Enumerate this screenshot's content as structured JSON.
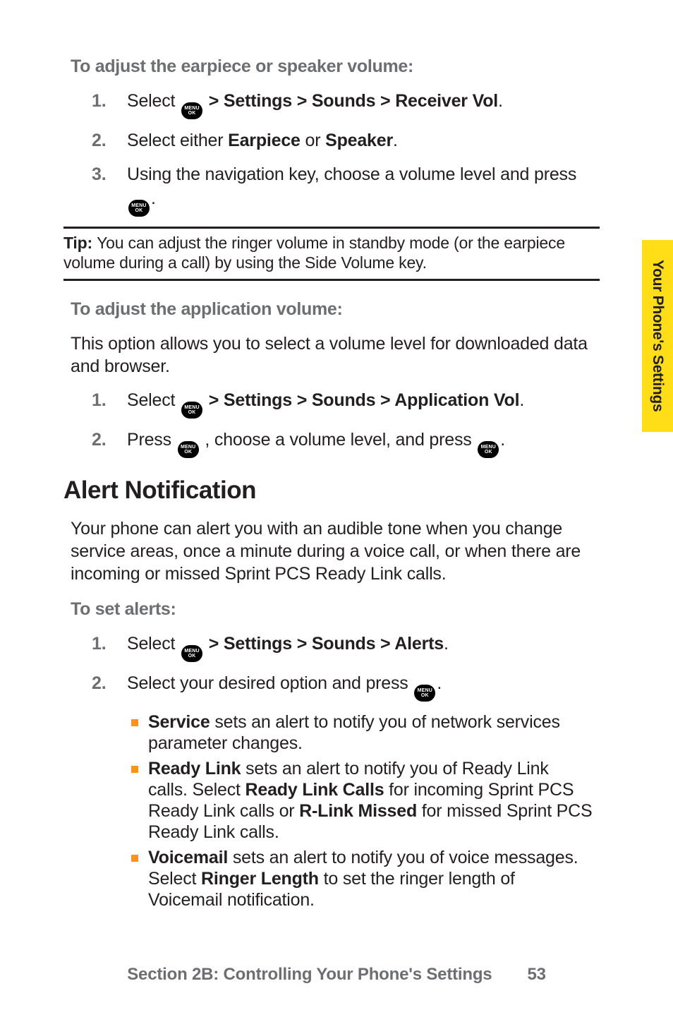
{
  "sidetab": {
    "label": "Your Phone's Settings"
  },
  "sec1": {
    "heading": "To adjust the earpiece or speaker volume:",
    "steps": [
      {
        "num": "1.",
        "pre": "Select ",
        "post": " > Settings > Sounds > Receiver Vol",
        "end": "."
      },
      {
        "num": "2.",
        "text_a": "Select either ",
        "b1": "Earpiece",
        "mid": " or ",
        "b2": "Speaker",
        "end": "."
      },
      {
        "num": "3.",
        "text": "Using the navigation key, choose a volume level and press ",
        "end": "."
      }
    ]
  },
  "tip": {
    "label": "Tip: ",
    "text": "You can adjust the ringer volume in standby mode (or the earpiece volume during a call) by using the Side Volume key."
  },
  "sec2": {
    "heading": "To adjust the application volume:",
    "intro": "This option allows you to select a volume level for downloaded data and browser.",
    "steps": [
      {
        "num": "1.",
        "pre": "Select ",
        "post": " > Settings > Sounds > Application Vol",
        "end": "."
      },
      {
        "num": "2.",
        "pre": "Press ",
        "mid": " , choose a volume level, and press ",
        "end": "."
      }
    ]
  },
  "sec3": {
    "title": "Alert Notification",
    "intro": "Your phone can alert you with an audible tone when you change service areas, once a minute during a voice call, or when there are incoming or missed Sprint PCS Ready Link calls.",
    "heading": "To set alerts:",
    "steps": [
      {
        "num": "1.",
        "pre": "Select ",
        "post": " > Settings > Sounds > Alerts",
        "end": "."
      },
      {
        "num": "2.",
        "pre": "Select your desired option and press ",
        "end": "."
      }
    ],
    "bullets": [
      {
        "b": "Service",
        "rest": " sets an alert to notify you of network services parameter changes."
      },
      {
        "b": "Ready Link",
        "rest_a": " sets an alert to notify you of Ready Link calls. Select ",
        "b2": "Ready Link Calls",
        "rest_b": " for incoming Sprint PCS Ready Link calls or ",
        "b3": "R-Link Missed",
        "rest_c": " for missed Sprint PCS Ready Link calls."
      },
      {
        "b": "Voicemail",
        "rest_a": " sets an alert to notify you of voice messages. Select ",
        "b2": "Ringer Length",
        "rest_b": " to set the ringer length of Voicemail notification."
      }
    ]
  },
  "footer": {
    "section": "Section 2B: Controlling Your Phone's Settings",
    "page": "53"
  },
  "icon": {
    "line1": "MENU",
    "line2": "OK"
  }
}
